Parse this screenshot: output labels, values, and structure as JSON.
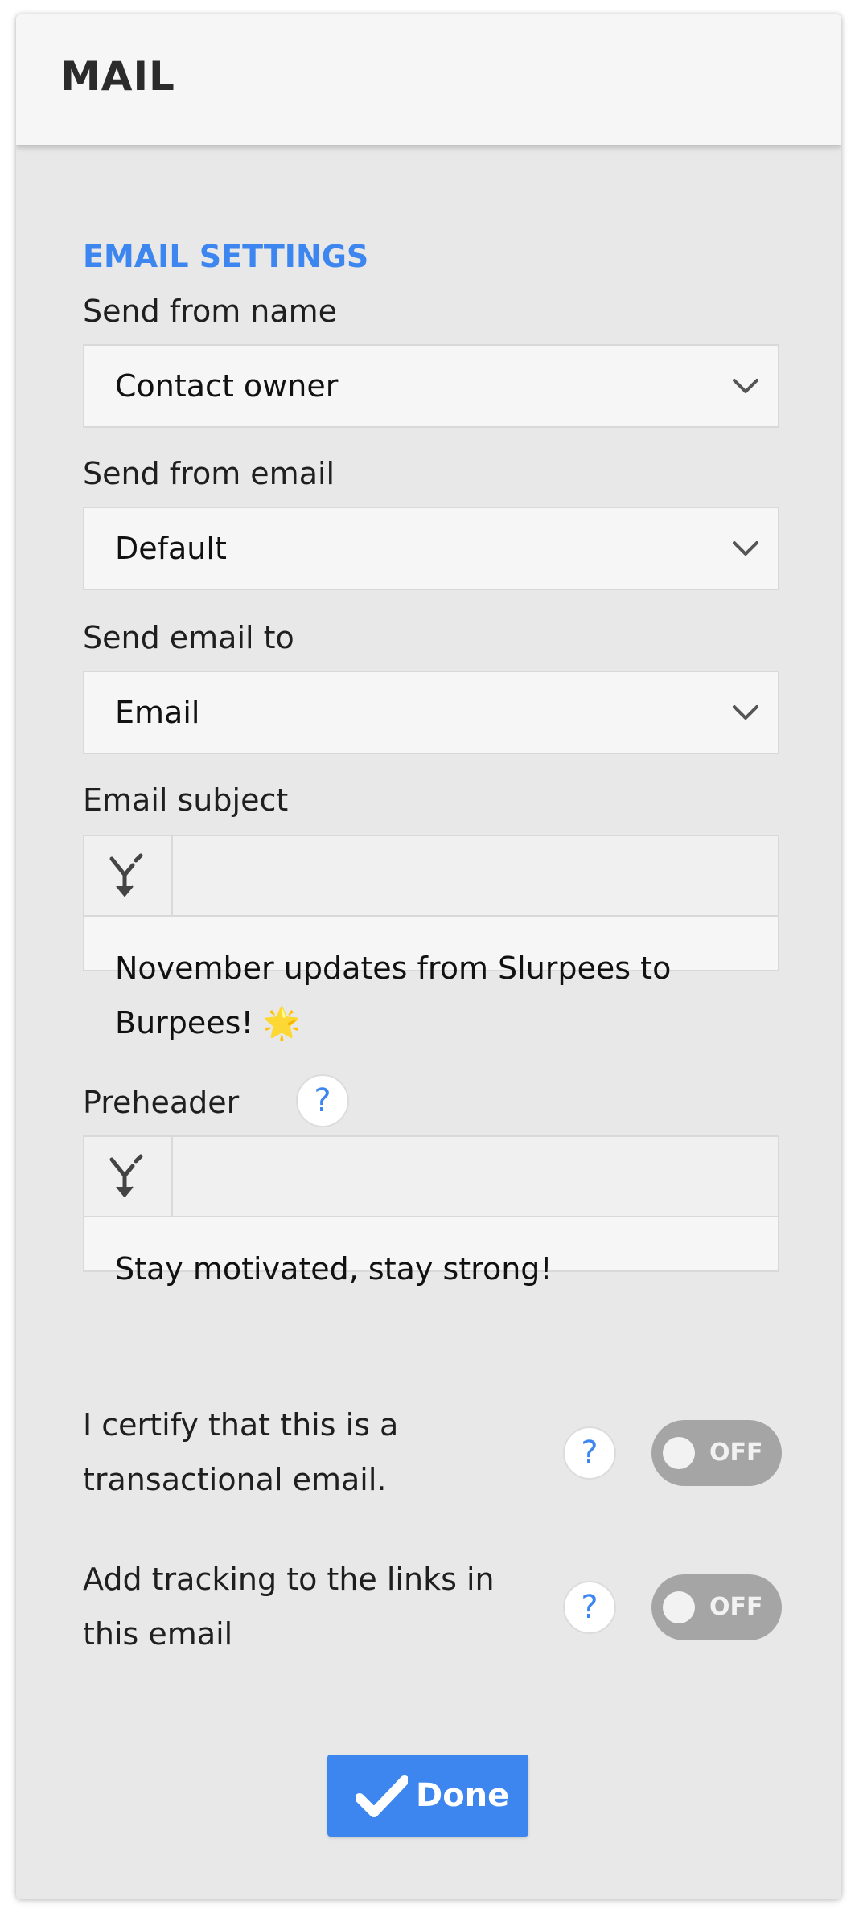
{
  "panel": {
    "title": "MAIL"
  },
  "settings": {
    "section_title": "EMAIL SETTINGS",
    "send_from_name": {
      "label": "Send from name",
      "value": "Contact owner"
    },
    "send_from_email": {
      "label": "Send from email",
      "value": "Default"
    },
    "send_email_to": {
      "label": "Send email to",
      "value": "Email"
    },
    "email_subject": {
      "label": "Email subject",
      "value": "November updates from Slurpees to Burpees!",
      "emoji": "🌟"
    },
    "preheader": {
      "label": "Preheader",
      "help_icon": "?",
      "value": "Stay motivated, stay strong!"
    },
    "transactional": {
      "label": "I certify that this is a transactional email.",
      "help_icon": "?",
      "state": "OFF"
    },
    "tracking": {
      "label": "Add tracking to the links in this email",
      "help_icon": "?",
      "state": "OFF"
    }
  },
  "actions": {
    "done_label": "Done"
  },
  "colors": {
    "accent": "#3d86f0",
    "panel_bg": "#e8e8e8",
    "toggle_off": "#a5a5a5"
  },
  "icons": {
    "chevron": "chevron-down-icon",
    "merge": "personalization-merge-icon",
    "help": "question-mark-icon",
    "done": "checkmark-icon"
  }
}
